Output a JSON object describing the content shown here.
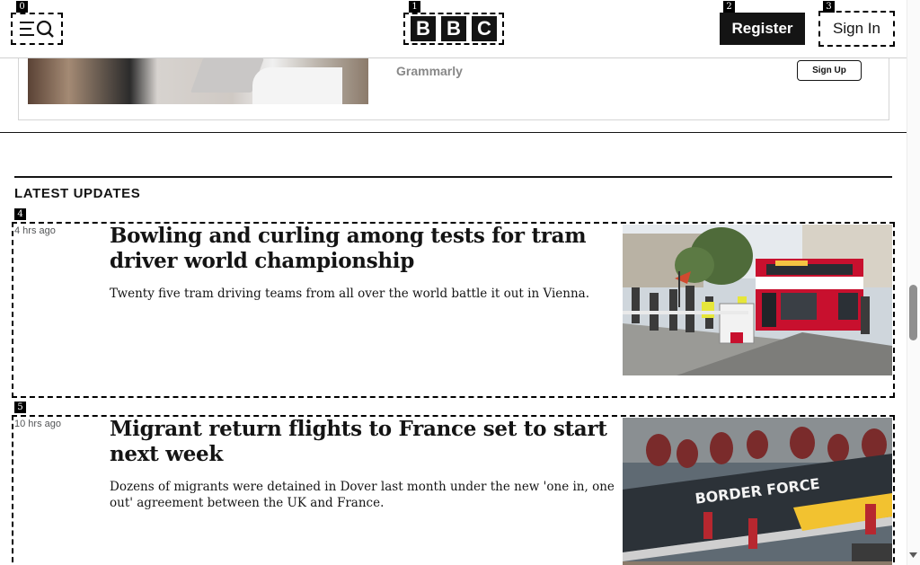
{
  "markers": [
    "0",
    "1",
    "2",
    "3",
    "4",
    "5"
  ],
  "header": {
    "menu_icon": "menu-search-icon",
    "logo_letters": [
      "B",
      "B",
      "C"
    ],
    "register_label": "Register",
    "signin_label": "Sign In"
  },
  "ad": {
    "brand": "Grammarly",
    "cta_label": "Sign Up"
  },
  "section": {
    "title": "LATEST UPDATES"
  },
  "articles": [
    {
      "time": "4 hrs ago",
      "headline": "Bowling and curling among tests for tram driver world championship",
      "summary": "Twenty five tram driving teams from all over the world battle it out in Vienna."
    },
    {
      "time": "10 hrs ago",
      "headline": "Migrant return flights to France set to start next week",
      "summary": "Dozens of migrants were detained in Dover last month under the new 'one in, one out' agreement between the UK and France.",
      "image_text": "BORDER FORCE"
    }
  ],
  "colors": {
    "text": "#141414",
    "muted": "#545658",
    "tram_red": "#c8102e"
  }
}
